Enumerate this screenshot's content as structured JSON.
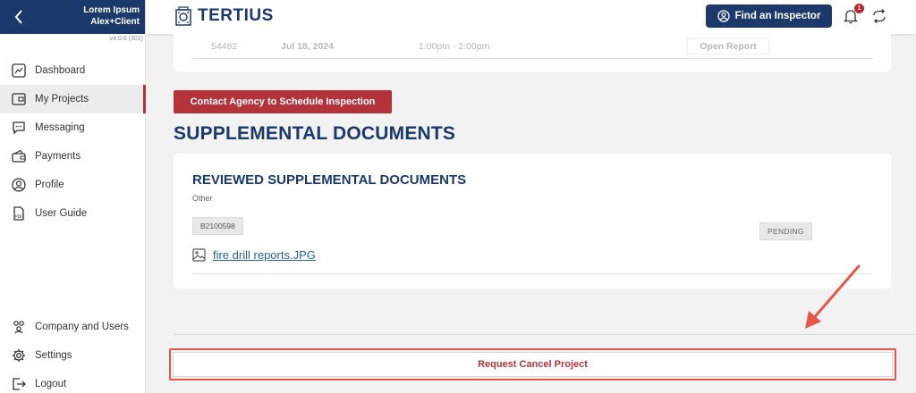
{
  "sidebar": {
    "user_line1": "Lorem Ipsum",
    "user_line2": "Alex+Client",
    "version": "v4.0.6 (301)",
    "nav_top": [
      {
        "label": "Dashboard",
        "icon": "dashboard-icon"
      },
      {
        "label": "My Projects",
        "icon": "projects-icon",
        "active": true
      },
      {
        "label": "Messaging",
        "icon": "messaging-icon"
      },
      {
        "label": "Payments",
        "icon": "wallet-icon"
      },
      {
        "label": "Profile",
        "icon": "profile-icon"
      },
      {
        "label": "User Guide",
        "icon": "pdf-icon"
      }
    ],
    "nav_bottom": [
      {
        "label": "Company and Users",
        "icon": "users-icon"
      },
      {
        "label": "Settings",
        "icon": "gear-icon"
      },
      {
        "label": "Logout",
        "icon": "logout-icon"
      }
    ]
  },
  "header": {
    "brand": "TERTIUS",
    "find_inspector": "Find an Inspector",
    "notification_count": "1",
    "colors": {
      "brand": "#1b3a6b",
      "accent": "#b4333b"
    }
  },
  "inspection_row": {
    "id": "54482",
    "date": "Jul 18, 2024",
    "time": "1:00pm - 2:00pm",
    "action": "Open Report"
  },
  "contact_button": "Contact Agency to Schedule Inspection",
  "section_title": "SUPPLEMENTAL DOCUMENTS",
  "document": {
    "title": "REVIEWED SUPPLEMENTAL DOCUMENTS",
    "subtitle": "Other",
    "code": "B2100598",
    "status": "PENDING",
    "file_name": "fire drill reports.JPG"
  },
  "cancel_button": "Request Cancel Project"
}
